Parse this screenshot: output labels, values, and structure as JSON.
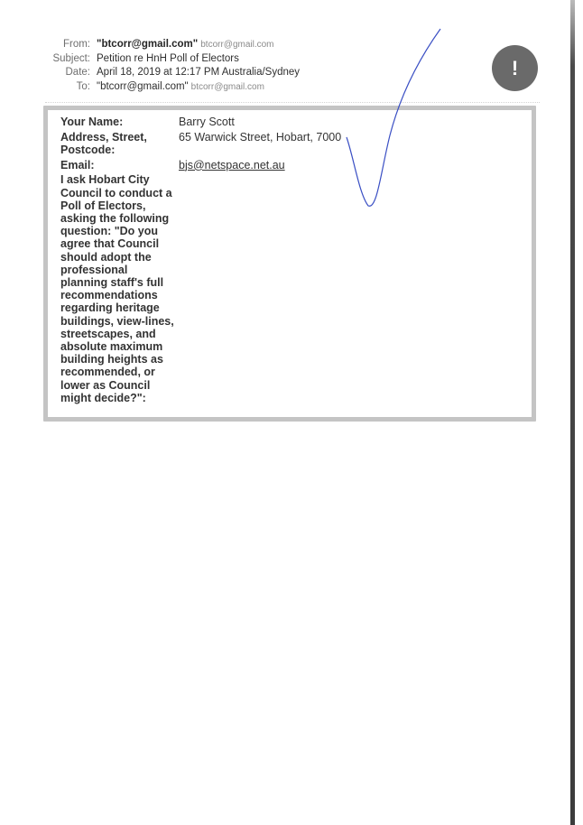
{
  "email_header": {
    "from_label": "From:",
    "from_name": "\"btcorr@gmail.com\"",
    "from_address": "btcorr@gmail.com",
    "subject_label": "Subject:",
    "subject": "Petition re HnH Poll of Electors",
    "date_label": "Date:",
    "date": "April 18, 2019 at 12:17 PM Australia/Sydney",
    "to_label": "To:",
    "to_name": "\"btcorr@gmail.com\"",
    "to_address": "btcorr@gmail.com"
  },
  "alert_icon": {
    "symbol": "!",
    "color": "#6a6a6a"
  },
  "form": {
    "name_label": "Your Name:",
    "name_value": "Barry Scott",
    "address_label": "Address, Street, Postcode:",
    "address_value": "65 Warwick Street, Hobart, 7000",
    "email_label": "Email:",
    "email_value": "bjs@netspace.net.au",
    "question": "I ask Hobart City Council to conduct a Poll of Electors, asking the following question: \"Do you agree that Council should adopt the professional planning staff's full recommendations regarding heritage buildings, view-lines, streetscapes, and absolute maximum building heights as recommended, or lower as Council might decide?\":"
  },
  "annotation": {
    "type": "handwritten-tick",
    "color": "#3a4fc4"
  }
}
